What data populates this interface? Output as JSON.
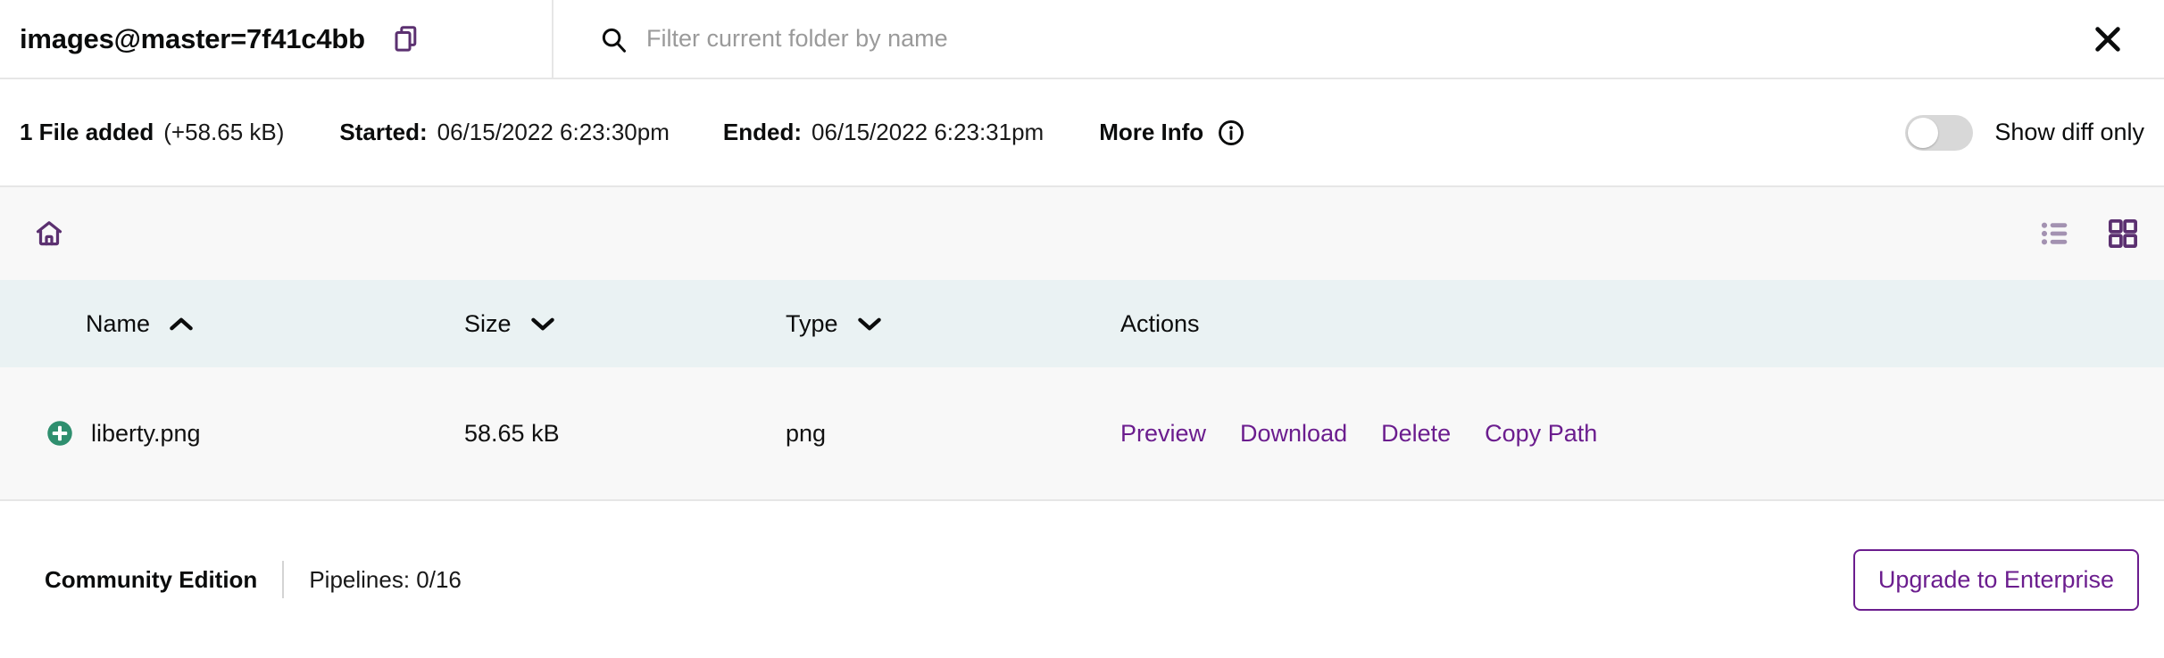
{
  "header": {
    "repo_title": "images@master=7f41c4bb",
    "copy_icon": "copy-icon",
    "search_icon": "search-icon",
    "search_placeholder": "Filter current folder by name",
    "search_value": "",
    "close_icon": "close-icon"
  },
  "info": {
    "files_added_label": "1 File added",
    "files_added_size": "(+58.65 kB)",
    "started_label": "Started:",
    "started_value": "06/15/2022 6:23:30pm",
    "ended_label": "Ended:",
    "ended_value": "06/15/2022 6:23:31pm",
    "more_info_label": "More Info",
    "more_info_icon": "info-circle-icon",
    "diff_toggle_label": "Show diff only",
    "diff_toggle_state": "off"
  },
  "toolbar": {
    "home_icon": "home-icon",
    "list_view_icon": "list-view-icon",
    "grid_view_icon": "grid-view-icon",
    "active_view": "grid"
  },
  "table": {
    "columns": [
      {
        "label": "Name",
        "sort": "asc"
      },
      {
        "label": "Size",
        "sort": "desc"
      },
      {
        "label": "Type",
        "sort": "desc"
      },
      {
        "label": "Actions",
        "sort": "none"
      }
    ],
    "rows": [
      {
        "status_icon": "added-plus-icon",
        "name": "liberty.png",
        "size": "58.65 kB",
        "type": "png",
        "actions": [
          "Preview",
          "Download",
          "Delete",
          "Copy Path"
        ]
      }
    ]
  },
  "footer": {
    "edition": "Community Edition",
    "pipelines": "Pipelines: 0/16",
    "upgrade_label": "Upgrade to Enterprise"
  },
  "colors": {
    "accent_purple": "#6b1d8e",
    "icon_purple": "#5b3070",
    "icon_purple_muted": "#9b8aa8",
    "added_green": "#2f8f6f",
    "table_header_bg": "#eaf2f3",
    "row_bg": "#f8f8f8",
    "toolbar_bg": "#f8f8f8",
    "border": "#e6e6e6",
    "toggle_track": "#d8d8d8"
  }
}
